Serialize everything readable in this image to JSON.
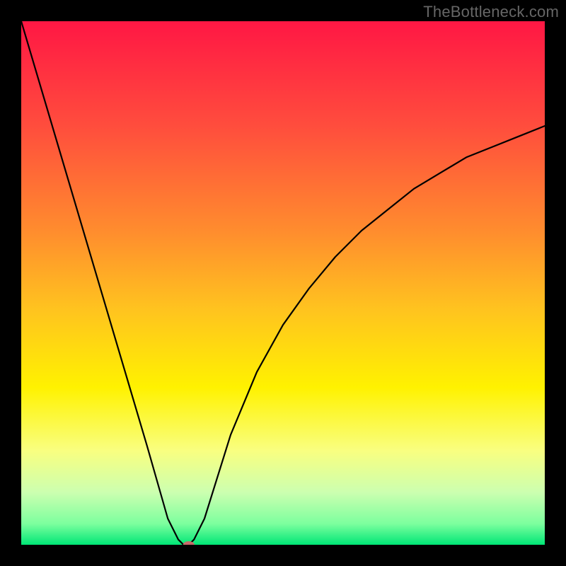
{
  "watermark": "TheBottleneck.com",
  "chart_data": {
    "type": "line",
    "title": "",
    "xlabel": "",
    "ylabel": "",
    "xlim": [
      0,
      100
    ],
    "ylim": [
      0,
      100
    ],
    "grid": false,
    "curve_x_y": [
      [
        0,
        100
      ],
      [
        8,
        73
      ],
      [
        16,
        46
      ],
      [
        24,
        19
      ],
      [
        28,
        5
      ],
      [
        30,
        1
      ],
      [
        31,
        0
      ],
      [
        32,
        0
      ],
      [
        33,
        1
      ],
      [
        35,
        5
      ],
      [
        40,
        21
      ],
      [
        45,
        33
      ],
      [
        50,
        42
      ],
      [
        55,
        49
      ],
      [
        60,
        55
      ],
      [
        65,
        60
      ],
      [
        70,
        64
      ],
      [
        75,
        68
      ],
      [
        80,
        71
      ],
      [
        85,
        74
      ],
      [
        90,
        76
      ],
      [
        95,
        78
      ],
      [
        100,
        80
      ]
    ],
    "marker": {
      "x": 32,
      "y": 0,
      "color": "#c76a6a",
      "rx": 8,
      "ry": 5
    },
    "background_gradient_stops": [
      {
        "pos": 0.0,
        "color": "#ff1744"
      },
      {
        "pos": 0.2,
        "color": "#ff4d3d"
      },
      {
        "pos": 0.4,
        "color": "#ff8c2e"
      },
      {
        "pos": 0.55,
        "color": "#ffc31f"
      },
      {
        "pos": 0.7,
        "color": "#fff200"
      },
      {
        "pos": 0.82,
        "color": "#f9ff80"
      },
      {
        "pos": 0.9,
        "color": "#ccffb0"
      },
      {
        "pos": 0.96,
        "color": "#7cff9e"
      },
      {
        "pos": 1.0,
        "color": "#00e676"
      }
    ]
  }
}
